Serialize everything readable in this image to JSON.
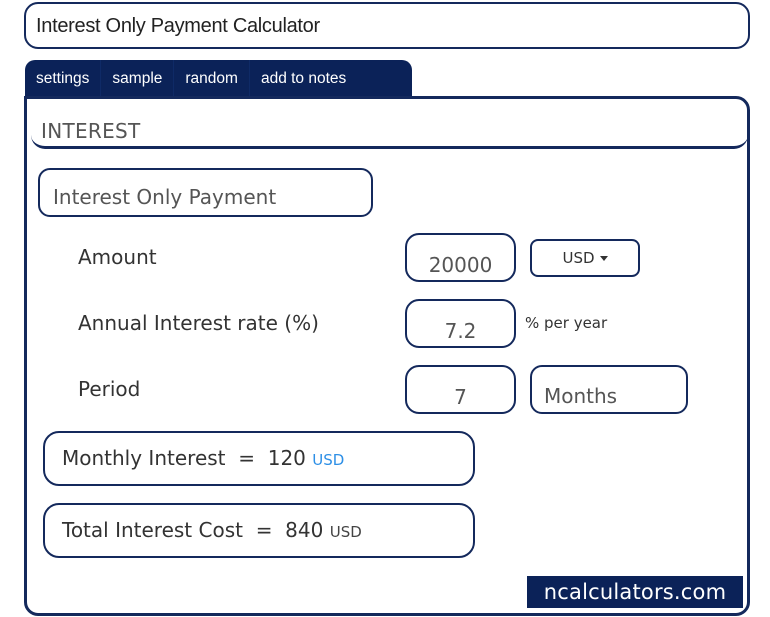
{
  "header": {
    "title": "Interest Only Payment Calculator"
  },
  "tabs": [
    {
      "label": "settings"
    },
    {
      "label": "sample"
    },
    {
      "label": "random"
    },
    {
      "label": "add to notes"
    }
  ],
  "section": {
    "title": "INTEREST"
  },
  "calculator": {
    "name": "Interest Only Payment",
    "fields": {
      "amount": {
        "label": "Amount",
        "value": "20000",
        "currency": "USD"
      },
      "rate": {
        "label": "Annual Interest rate (%)",
        "value": "7.2",
        "unit": "% per year"
      },
      "period": {
        "label": "Period",
        "value": "7",
        "unit": "Months"
      }
    },
    "results": {
      "monthly": {
        "label": "Monthly Interest",
        "equals": "=",
        "value": "120",
        "currency": "USD"
      },
      "total": {
        "label": "Total Interest Cost",
        "equals": "=",
        "value": "840",
        "currency": "USD"
      }
    }
  },
  "brand": {
    "text": "ncalculators.com"
  },
  "colors": {
    "navy": "#0b2258",
    "border": "#14295c",
    "link_blue": "#2d8fe6"
  },
  "icons": {
    "currency_dropdown": "caret-down-icon"
  }
}
